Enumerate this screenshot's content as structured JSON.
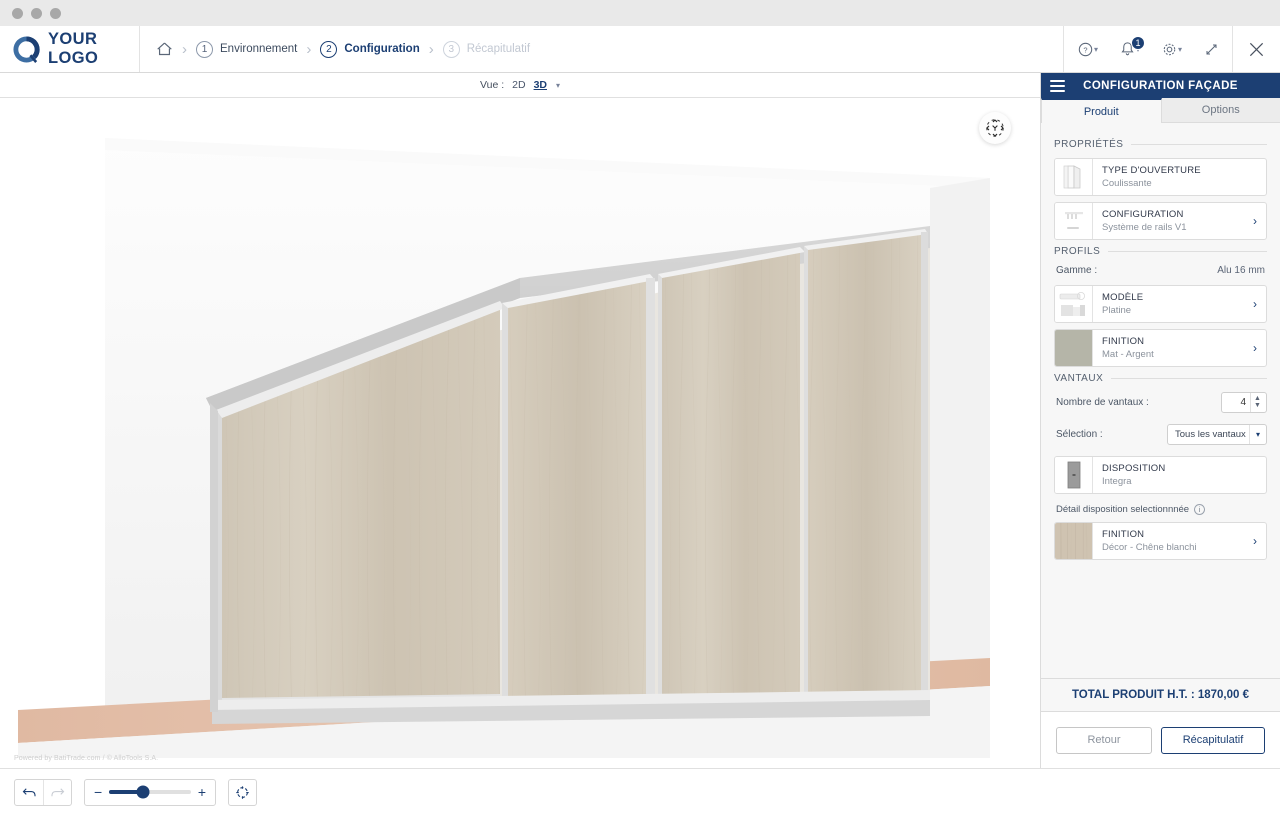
{
  "window": {
    "dots": 3
  },
  "header": {
    "logo_text": "YOUR LOGO",
    "breadcrumb": [
      {
        "num": "1",
        "label": "Environnement",
        "state": "done"
      },
      {
        "num": "2",
        "label": "Configuration",
        "state": "active"
      },
      {
        "num": "3",
        "label": "Récapitulatif",
        "state": "disabled"
      }
    ],
    "tools": [
      {
        "name": "help-icon",
        "caret": true
      },
      {
        "name": "notifications-icon",
        "caret": true,
        "badge": "1"
      },
      {
        "name": "settings-gear-icon",
        "caret": true
      },
      {
        "name": "fullscreen-expand-icon",
        "caret": false
      }
    ],
    "close_label": "✕"
  },
  "viewer": {
    "view_label": "Vue :",
    "view_options": [
      {
        "label": "2D",
        "selected": false
      },
      {
        "label": "3D",
        "selected": true
      }
    ],
    "powered_by": "Powered by BatiTrade.com / © AlloTools S.A.",
    "gizmo_name": "orbit-gizmo"
  },
  "panel": {
    "title": "CONFIGURATION FAÇADE",
    "tabs": [
      {
        "label": "Produit",
        "active": true
      },
      {
        "label": "Options",
        "active": false
      }
    ],
    "sections": {
      "proprietes": {
        "title": "PROPRIÉTÉS",
        "cards": [
          {
            "title": "TYPE D'OUVERTURE",
            "subtitle": "Coulissante",
            "arrow": false,
            "thumb": "door-panel-thumb"
          },
          {
            "title": "CONFIGURATION",
            "subtitle": "Système de rails V1",
            "arrow": true,
            "thumb": "rail-system-thumb"
          }
        ]
      },
      "profils": {
        "title": "PROFILS",
        "gamme_label": "Gamme :",
        "gamme_value": "Alu 16 mm",
        "cards": [
          {
            "title": "MODÈLE",
            "subtitle": "Platine",
            "arrow": true,
            "thumb": "profile-model-thumb"
          },
          {
            "title": "FINITION",
            "subtitle": "Mat - Argent",
            "arrow": true,
            "thumb": "swatch-silver",
            "swatch": "#b5b5a8"
          }
        ]
      },
      "vantaux": {
        "title": "VANTAUX",
        "count_label": "Nombre de vantaux :",
        "count_value": "4",
        "selection_label": "Sélection :",
        "selection_value": "Tous les vantaux",
        "disposition_card": {
          "title": "DISPOSITION",
          "subtitle": "Integra",
          "arrow": false,
          "thumb": "disposition-integra-thumb"
        },
        "detail_label": "Détail disposition selectionnnée",
        "detail_card": {
          "title": "FINITION",
          "subtitle": "Décor - Chêne blanchi",
          "arrow": true,
          "thumb": "swatch-oak"
        }
      }
    },
    "total_label": "TOTAL PRODUIT H.T. : 1870,00 €",
    "buttons": {
      "back": "Retour",
      "next": "Récapitulatif"
    }
  },
  "bottombar": {
    "undo_name": "undo-icon",
    "redo_name": "redo-icon",
    "zoom_out": "−",
    "zoom_in": "+",
    "zoom_percent": 42,
    "recenter_name": "recenter-icon"
  },
  "colors": {
    "brand_blue": "#1c3f73",
    "panel_bg": "#f7f7f7",
    "wood": "#cfc4b4",
    "floor": "#e4bfa9"
  }
}
